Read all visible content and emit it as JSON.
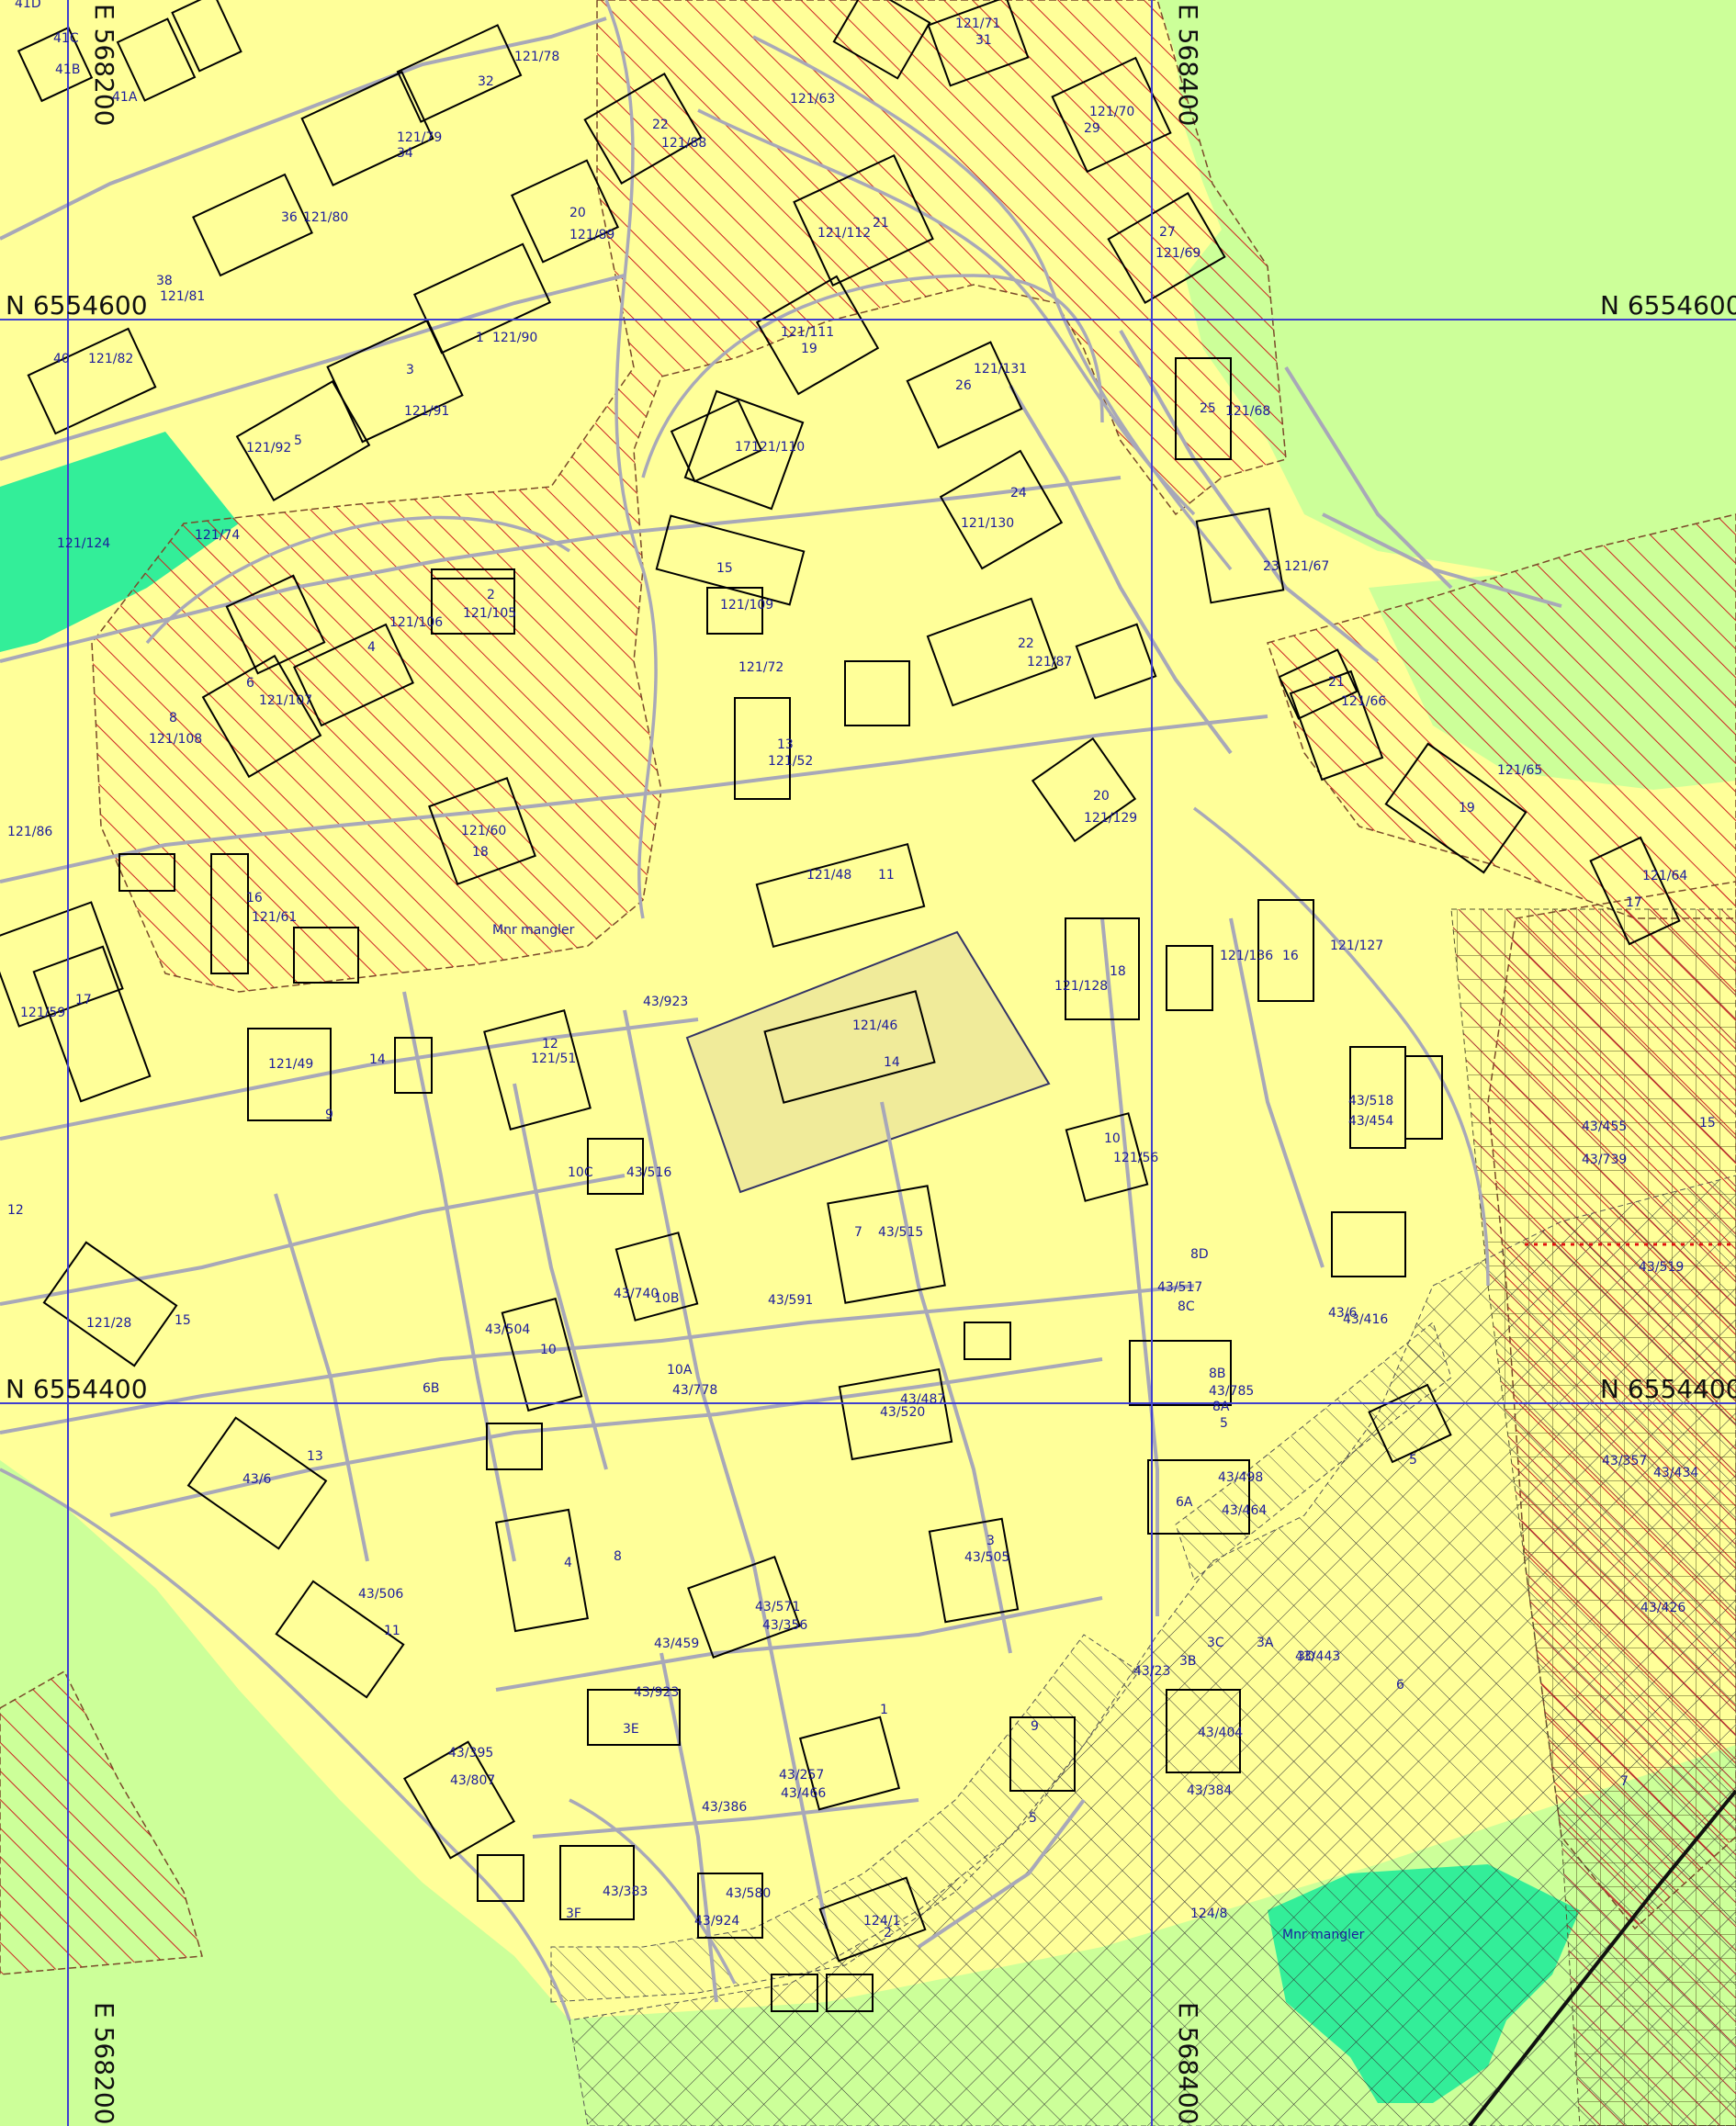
{
  "colors": {
    "residential": "#ffff99",
    "green": "#ccff99",
    "dark_green": "#33ee99",
    "grid_line": "#4040d0",
    "parcel_line": "#a8a8b8",
    "hatch_red": "#cc2222",
    "building_stroke": "#000000",
    "highlight_parcel": "#f0eb9a"
  },
  "grid": {
    "northings": [
      {
        "label": "N 6554600",
        "value": 6554600
      },
      {
        "label": "N 6554400",
        "value": 6554400
      }
    ],
    "eastings": [
      {
        "label": "E 568200",
        "value": 568200
      },
      {
        "label": "E 568400",
        "value": 568400
      }
    ]
  },
  "zones": [
    {
      "name": "green-area",
      "type": "green"
    },
    {
      "name": "conservation-hatch",
      "type": "red-hatch"
    },
    {
      "name": "grid-hatch",
      "type": "crosshatch"
    },
    {
      "name": "dark-green-area",
      "type": "dark-green"
    }
  ],
  "labels": [
    "41D",
    "41C",
    "41B",
    "41A",
    "121/78",
    "32",
    "22",
    "121/88",
    "121/63",
    "121/71",
    "31",
    "121/70",
    "29",
    "121/79",
    "34",
    "36",
    "121/80",
    "20",
    "121/89",
    "21",
    "121/112",
    "27",
    "121/69",
    "38",
    "121/81",
    "1",
    "121/90",
    "121/111",
    "19",
    "121/131",
    "26",
    "40",
    "121/82",
    "3",
    "121/91",
    "25",
    "121/68",
    "5",
    "121/92",
    "17",
    "121/110",
    "24",
    "121/130",
    "121/124",
    "121/74",
    "2",
    "121/105",
    "15",
    "121/109",
    "23",
    "121/67",
    "4",
    "121/106",
    "121/72",
    "22",
    "121/87",
    "21",
    "121/66",
    "6",
    "121/107",
    "8",
    "121/108",
    "13",
    "121/52",
    "20",
    "121/129",
    "121/65",
    "19",
    "121/86",
    "121/60",
    "18",
    "11",
    "121/48",
    "121/64",
    "17",
    "16",
    "121/61",
    "Mnr mangler",
    "121/127",
    "18",
    "121/128",
    "121/136",
    "16",
    "121/59",
    "17",
    "43/923",
    "12",
    "121/51",
    "14",
    "121/49",
    "9",
    "121/46",
    "14",
    "43/518",
    "43/454",
    "43/455",
    "15",
    "43/739",
    "10C",
    "43/516",
    "10",
    "121/56",
    "12",
    "43/519",
    "43/515",
    "7",
    "8D",
    "43/517",
    "8C",
    "15",
    "121/28",
    "43/740",
    "10B",
    "43/591",
    "43/6",
    "43/416",
    "43/504",
    "10",
    "10A",
    "43/778",
    "8B",
    "43/785",
    "8A",
    "5",
    "43/487",
    "43/520",
    "5",
    "43/357",
    "43/434",
    "13",
    "43/6",
    "6B",
    "43/498",
    "6A",
    "43/464",
    "3",
    "43/505",
    "8",
    "4",
    "43/571",
    "43/356",
    "43/426",
    "43/506",
    "11",
    "43/459",
    "3C",
    "3B",
    "3A",
    "3D",
    "43/23",
    "6",
    "43/443",
    "43/923",
    "3E",
    "1",
    "43/404",
    "9",
    "43/395",
    "43/807",
    "43/257",
    "43/466",
    "43/384",
    "7",
    "43/386",
    "5",
    "43/383",
    "3F",
    "43/580",
    "43/924",
    "124/1",
    "2",
    "124/8",
    "Mnr mangler"
  ],
  "highlight": {
    "parcel": "121/46",
    "building": "9"
  }
}
